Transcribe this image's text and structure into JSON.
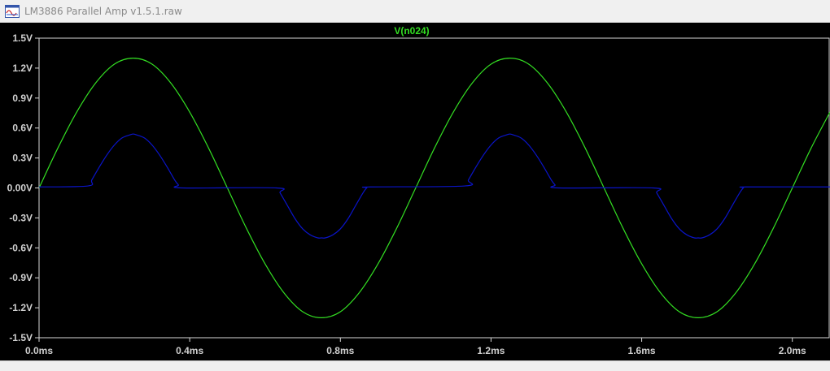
{
  "window": {
    "title": "LM3886 Parallel Amp v1.5.1.raw",
    "icon": "waveform-viewer-icon"
  },
  "colors": {
    "background": "#000000",
    "axis": "#d8d8d8",
    "tick_label": "#d0d0d0",
    "trace_green": "#33dd22",
    "trace_blue": "#0a14c8",
    "title": "#33dd22"
  },
  "chart_data": {
    "type": "line",
    "title": "V(n024)",
    "xlabel": "",
    "ylabel": "",
    "x_unit": "ms",
    "xlim": [
      0,
      2.1
    ],
    "ylim": [
      -1.5,
      1.5
    ],
    "x_ticks": [
      0.0,
      0.4,
      0.8,
      1.2,
      1.6,
      2.0
    ],
    "x_tick_labels": [
      "0.0ms",
      "0.4ms",
      "0.8ms",
      "1.2ms",
      "1.6ms",
      "2.0ms"
    ],
    "y_ticks": [
      1.5,
      1.2,
      0.9,
      0.6,
      0.3,
      0.0,
      -0.3,
      -0.6,
      -0.9,
      -1.2,
      -1.5
    ],
    "y_tick_labels": [
      "1.5V",
      "1.2V",
      "0.9V",
      "0.6V",
      "0.3V",
      "0.00V",
      "-0.3V",
      "-0.6V",
      "-0.9V",
      "-1.2V",
      "-1.5V"
    ],
    "grid": false,
    "series": [
      {
        "name": "V(n024)",
        "color": "#33dd22",
        "x": [
          0.0,
          0.05,
          0.1,
          0.15,
          0.2,
          0.25,
          0.3,
          0.35,
          0.4,
          0.45,
          0.5,
          0.55,
          0.6,
          0.65,
          0.7,
          0.75,
          0.8,
          0.85,
          0.9,
          0.95,
          1.0,
          1.05,
          1.1,
          1.15,
          1.2,
          1.25,
          1.3,
          1.35,
          1.4,
          1.45,
          1.5,
          1.55,
          1.6,
          1.65,
          1.7,
          1.75,
          1.8,
          1.85,
          1.9,
          1.95,
          2.0,
          2.05,
          2.1
        ],
        "values": [
          0.0,
          0.4,
          0.76,
          1.05,
          1.24,
          1.3,
          1.24,
          1.05,
          0.76,
          0.4,
          0.0,
          -0.4,
          -0.76,
          -1.05,
          -1.24,
          -1.3,
          -1.24,
          -1.05,
          -0.76,
          -0.4,
          0.0,
          0.4,
          0.76,
          1.05,
          1.24,
          1.3,
          1.24,
          1.05,
          0.76,
          0.4,
          0.0,
          -0.4,
          -0.76,
          -1.05,
          -1.24,
          -1.3,
          -1.24,
          -1.05,
          -0.76,
          -0.4,
          0.0,
          0.4,
          0.76
        ]
      },
      {
        "name": "",
        "color": "#0a14c8",
        "x": [
          0.0,
          0.13,
          0.14,
          0.16,
          0.18,
          0.2,
          0.22,
          0.24,
          0.25,
          0.26,
          0.28,
          0.3,
          0.32,
          0.34,
          0.36,
          0.37,
          0.38,
          0.63,
          0.64,
          0.66,
          0.68,
          0.7,
          0.72,
          0.74,
          0.75,
          0.76,
          0.78,
          0.8,
          0.82,
          0.84,
          0.86,
          0.87,
          0.88,
          1.13,
          1.14,
          1.16,
          1.18,
          1.2,
          1.22,
          1.24,
          1.25,
          1.26,
          1.28,
          1.3,
          1.32,
          1.34,
          1.36,
          1.37,
          1.38,
          1.63,
          1.64,
          1.66,
          1.68,
          1.7,
          1.72,
          1.74,
          1.75,
          1.76,
          1.78,
          1.8,
          1.82,
          1.84,
          1.86,
          1.87,
          1.88,
          2.1
        ],
        "values": [
          0.01,
          0.02,
          0.08,
          0.21,
          0.33,
          0.43,
          0.5,
          0.53,
          0.54,
          0.53,
          0.5,
          0.43,
          0.33,
          0.21,
          0.08,
          0.03,
          0.0,
          0.0,
          -0.05,
          -0.18,
          -0.31,
          -0.41,
          -0.47,
          -0.5,
          -0.5,
          -0.5,
          -0.47,
          -0.41,
          -0.31,
          -0.18,
          -0.05,
          0.0,
          0.01,
          0.02,
          0.08,
          0.21,
          0.33,
          0.43,
          0.5,
          0.53,
          0.54,
          0.53,
          0.5,
          0.43,
          0.33,
          0.21,
          0.08,
          0.03,
          0.0,
          0.0,
          -0.05,
          -0.18,
          -0.31,
          -0.41,
          -0.47,
          -0.5,
          -0.5,
          -0.5,
          -0.47,
          -0.41,
          -0.31,
          -0.18,
          -0.05,
          0.0,
          0.01,
          0.01
        ]
      }
    ]
  }
}
